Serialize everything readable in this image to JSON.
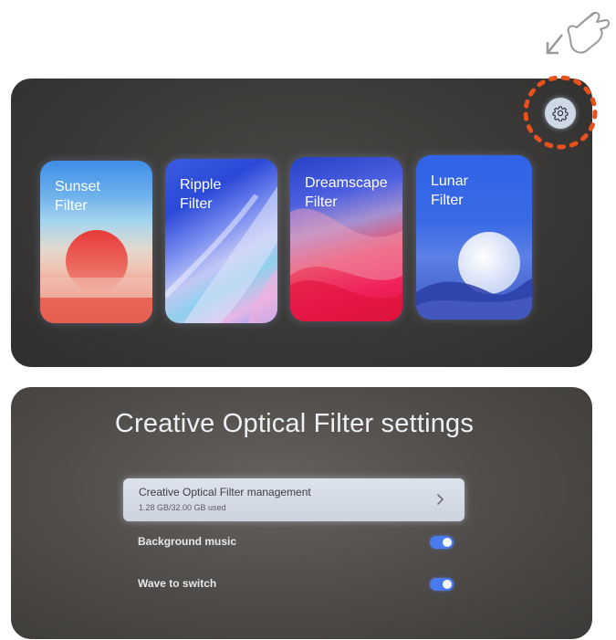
{
  "gesture": {
    "icon": "hand-pointer-icon"
  },
  "gallery": {
    "settings_icon": "gear-icon",
    "highlight_color": "#e8501c",
    "cards": [
      {
        "label": "Sunset\nFilter"
      },
      {
        "label": "Ripple\nFilter"
      },
      {
        "label": "Dreamscape\nFilter"
      },
      {
        "label": "Lunar\nFilter"
      }
    ]
  },
  "settings": {
    "title": "Creative Optical Filter settings",
    "management": {
      "title": "Creative Optical Filter management",
      "storage": "1.28 GB/32.00 GB used"
    },
    "toggles": [
      {
        "label": "Background music",
        "on": true
      },
      {
        "label": "Wave to switch",
        "on": true
      }
    ],
    "accent_color": "#4a7af0"
  }
}
